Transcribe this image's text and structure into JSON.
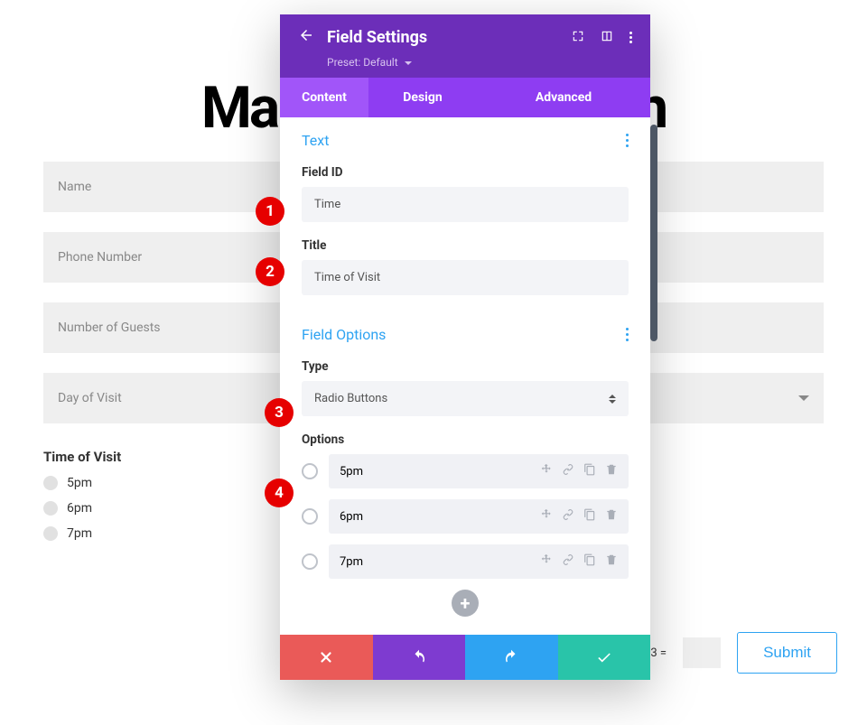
{
  "page": {
    "title": "Make a Reservation"
  },
  "form": {
    "name": "Name",
    "phone": "Phone Number",
    "guests": "Number of Guests",
    "day": "Day of Visit"
  },
  "visit": {
    "title": "Time of Visit",
    "opts": [
      "5pm",
      "6pm",
      "7pm"
    ]
  },
  "bottom": {
    "captcha": "12 +3 =",
    "submit": "Submit"
  },
  "modal": {
    "title": "Field Settings",
    "preset": "Preset: Default",
    "tabs": {
      "content": "Content",
      "design": "Design",
      "advanced": "Advanced"
    },
    "text": {
      "section": "Text",
      "fieldIdLabel": "Field ID",
      "fieldIdValue": "Time",
      "titleLabel": "Title",
      "titleValue": "Time of Visit"
    },
    "fieldOptions": {
      "section": "Field Options",
      "typeLabel": "Type",
      "typeValue": "Radio Buttons",
      "optionsLabel": "Options",
      "options": [
        "5pm",
        "6pm",
        "7pm"
      ]
    }
  },
  "badges": [
    "1",
    "2",
    "3",
    "4"
  ]
}
